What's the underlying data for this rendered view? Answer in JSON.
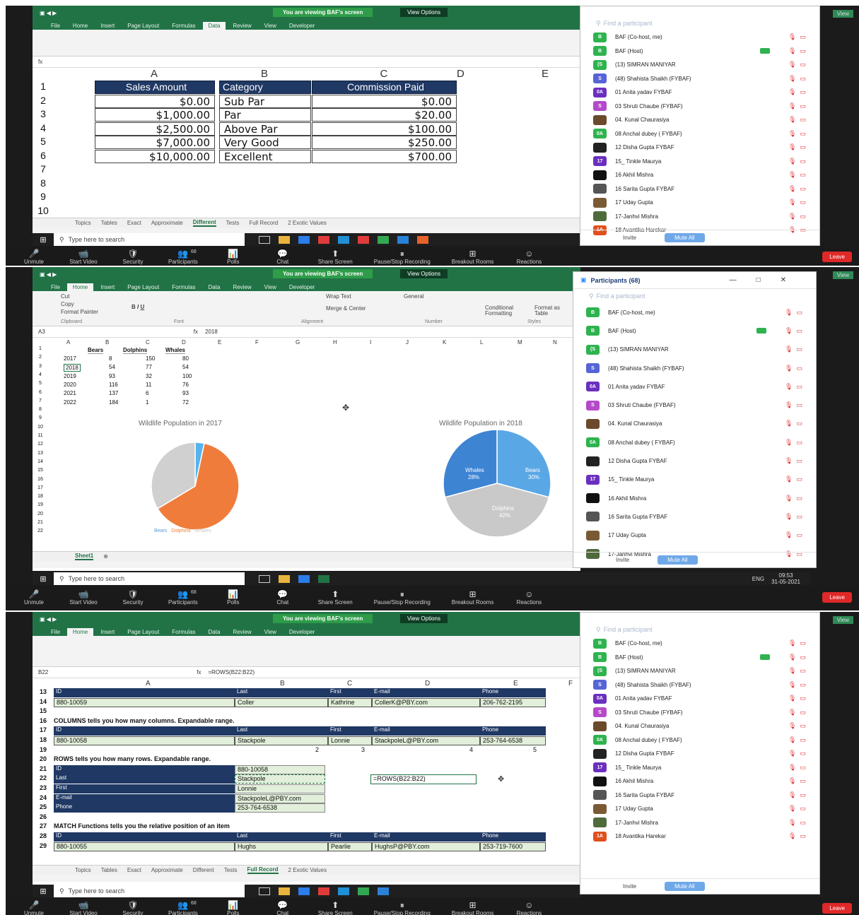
{
  "panel1": {
    "banner": "You are viewing BAF's screen",
    "view_options": "View Options",
    "tabs": [
      "File",
      "Home",
      "Insert",
      "Page Layout",
      "Formulas",
      "Data",
      "Review",
      "View",
      "Developer"
    ],
    "columns": [
      "A",
      "B",
      "C",
      "D",
      "E"
    ],
    "rows": [
      "1",
      "2",
      "3",
      "4",
      "5",
      "6",
      "7",
      "8",
      "9",
      "10"
    ],
    "header": [
      "Sales Amount",
      "Category",
      "Commission Paid"
    ],
    "data": [
      [
        "$0.00",
        "Sub Par",
        "$0.00"
      ],
      [
        "$1,000.00",
        "Par",
        "$20.00"
      ],
      [
        "$2,500.00",
        "Above Par",
        "$100.00"
      ],
      [
        "$7,000.00",
        "Very Good",
        "$250.00"
      ],
      [
        "$10,000.00",
        "Excellent",
        "$700.00"
      ]
    ],
    "sheets": [
      "Topics",
      "Tables",
      "Exact",
      "Approximate",
      "Different",
      "Tests",
      "Full Record",
      "2 Exotic Values"
    ],
    "active_sheet": "Different"
  },
  "panel2": {
    "banner": "You are viewing BAF's screen",
    "view_options": "View Options",
    "tabs": [
      "File",
      "Home",
      "Insert",
      "Page Layout",
      "Formulas",
      "Data",
      "Review",
      "View",
      "Developer"
    ],
    "ribbon": {
      "cut": "Cut",
      "copy": "Copy",
      "format_painter": "Format Painter",
      "wrap": "Wrap Text",
      "merge": "Merge & Center",
      "general": "General",
      "cond": "Conditional Formatting",
      "fmt_table": "Format as Table",
      "clipboard": "Clipboard",
      "font": "Font",
      "alignment": "Alignment",
      "number": "Number",
      "styles": "Styles"
    },
    "name_box": "A3",
    "formula": "2018",
    "table_header": [
      "Bears",
      "Dolphins",
      "Whales"
    ],
    "table_rows": [
      [
        "2017",
        "8",
        "150",
        "80"
      ],
      [
        "2018",
        "54",
        "77",
        "54"
      ],
      [
        "2019",
        "93",
        "32",
        "100"
      ],
      [
        "2020",
        "116",
        "11",
        "76"
      ],
      [
        "2021",
        "137",
        "6",
        "93"
      ],
      [
        "2022",
        "184",
        "1",
        "72"
      ]
    ],
    "col_letters": [
      "A",
      "B",
      "C",
      "D",
      "E",
      "F",
      "G",
      "H",
      "I",
      "J",
      "K",
      "L",
      "M",
      "N"
    ],
    "chart1_title": "Wildlife Population in 2017",
    "chart2_title": "Wildlife Population in 2018",
    "legend": [
      "Bears",
      "Dolphins",
      "Whales"
    ],
    "slice_labels": {
      "whales": "Whales",
      "whales_pct": "28%",
      "bears": "Bears",
      "bears_pct": "30%",
      "dolphins": "Dolphins",
      "dolphins_pct": "42%"
    },
    "sheet": "Sheet1",
    "time": "09:53",
    "date": "31-05-2021",
    "lang": "ENG",
    "participants_title": "Participants (68)"
  },
  "panel3": {
    "banner": "You are viewing BAF's screen",
    "view_options": "View Options",
    "name_box": "B22",
    "formula": "=ROWS(B22:B22)",
    "col_letters": [
      "A",
      "B",
      "C",
      "D",
      "E",
      "F"
    ],
    "fields": [
      "ID",
      "Last",
      "First",
      "E-mail",
      "Phone"
    ],
    "rec1": [
      "880-10059",
      "Coller",
      "Kathrine",
      "CollerK@PBY.com",
      "206-762-2195"
    ],
    "note1": "COLUMNS tells you how many columns. Expandable range.",
    "rec2": [
      "880-10058",
      "Stackpole",
      "Lonnie",
      "StackpoleL@PBY.com",
      "253-764-6538"
    ],
    "nums": [
      "2",
      "3",
      "4",
      "5"
    ],
    "note2": "ROWS tells you how many rows. Expandable range.",
    "vert_labels": [
      "ID",
      "Last",
      "First",
      "E-mail",
      "Phone"
    ],
    "vert_values": [
      "880-10058",
      "Stackpole",
      "Lonnie",
      "StackpoleL@PBY.com",
      "253-764-6538"
    ],
    "formula_cell": "=ROWS(B22:B22)",
    "note3": "MATCH Functions tells you the relative position of an item",
    "rec3": [
      "880-10055",
      "Hughs",
      "Pearlie",
      "HughsP@PBY.com",
      "253-719-7600"
    ],
    "row_nums": [
      "13",
      "14",
      "15",
      "16",
      "17",
      "18",
      "19",
      "20",
      "21",
      "22",
      "23",
      "24",
      "25",
      "26",
      "27",
      "28",
      "29"
    ],
    "sheets": [
      "Topics",
      "Tables",
      "Exact",
      "Approximate",
      "Different",
      "Tests",
      "Full Record",
      "2 Exotic Values"
    ],
    "active_sheet": "Full Record"
  },
  "taskbar": {
    "search": "Type here to search"
  },
  "zoom": {
    "controls": [
      "Unmute",
      "Start Video",
      "Security",
      "Participants",
      "Polls",
      "Chat",
      "Share Screen",
      "Pause/Stop Recording",
      "Breakout Rooms",
      "Reactions"
    ],
    "leave": "Leave",
    "view": "View",
    "participant_count": "68"
  },
  "participants": {
    "search": "Find a participant",
    "invite": "Invite",
    "mute_all": "Mute All",
    "list": [
      {
        "initials": "B",
        "name": "BAF (Co-host, me)",
        "color": "#2eb34f"
      },
      {
        "initials": "B",
        "name": "BAF (Host)",
        "color": "#2eb34f"
      },
      {
        "initials": "(S",
        "name": "(13) SIMRAN MANIYAR",
        "color": "#2eb34f"
      },
      {
        "initials": "S",
        "name": "(48) Shahista Shaikh (FYBAF)",
        "color": "#5664d6"
      },
      {
        "initials": "0A",
        "name": "01 Anita yadav FYBAF",
        "color": "#6b2fbf"
      },
      {
        "initials": "S",
        "name": "03 Shruti Chaube (FYBAF)",
        "color": "#b54ac9"
      },
      {
        "initials": "",
        "name": "04. Kunal Chaurasiya",
        "color": "#6b4a2b"
      },
      {
        "initials": "0A",
        "name": "08 Anchal dubey ( FYBAF)",
        "color": "#2eb34f"
      },
      {
        "initials": "",
        "name": "12 Disha Gupta FYBAF",
        "color": "#222222"
      },
      {
        "initials": "17",
        "name": "15_ Tinkle Maurya",
        "color": "#6b2fbf"
      },
      {
        "initials": "",
        "name": "16 Akhil Mishra",
        "color": "#111111"
      },
      {
        "initials": "",
        "name": "16 Sarita Gupta FYBAF",
        "color": "#555555"
      },
      {
        "initials": "",
        "name": "17 Uday Gupta",
        "color": "#7a5a35"
      },
      {
        "initials": "",
        "name": "17-Janhvi Mishra",
        "color": "#4e6b3c"
      },
      {
        "initials": "1A",
        "name": "18 Avantika Harekar",
        "color": "#e0501e"
      }
    ]
  }
}
